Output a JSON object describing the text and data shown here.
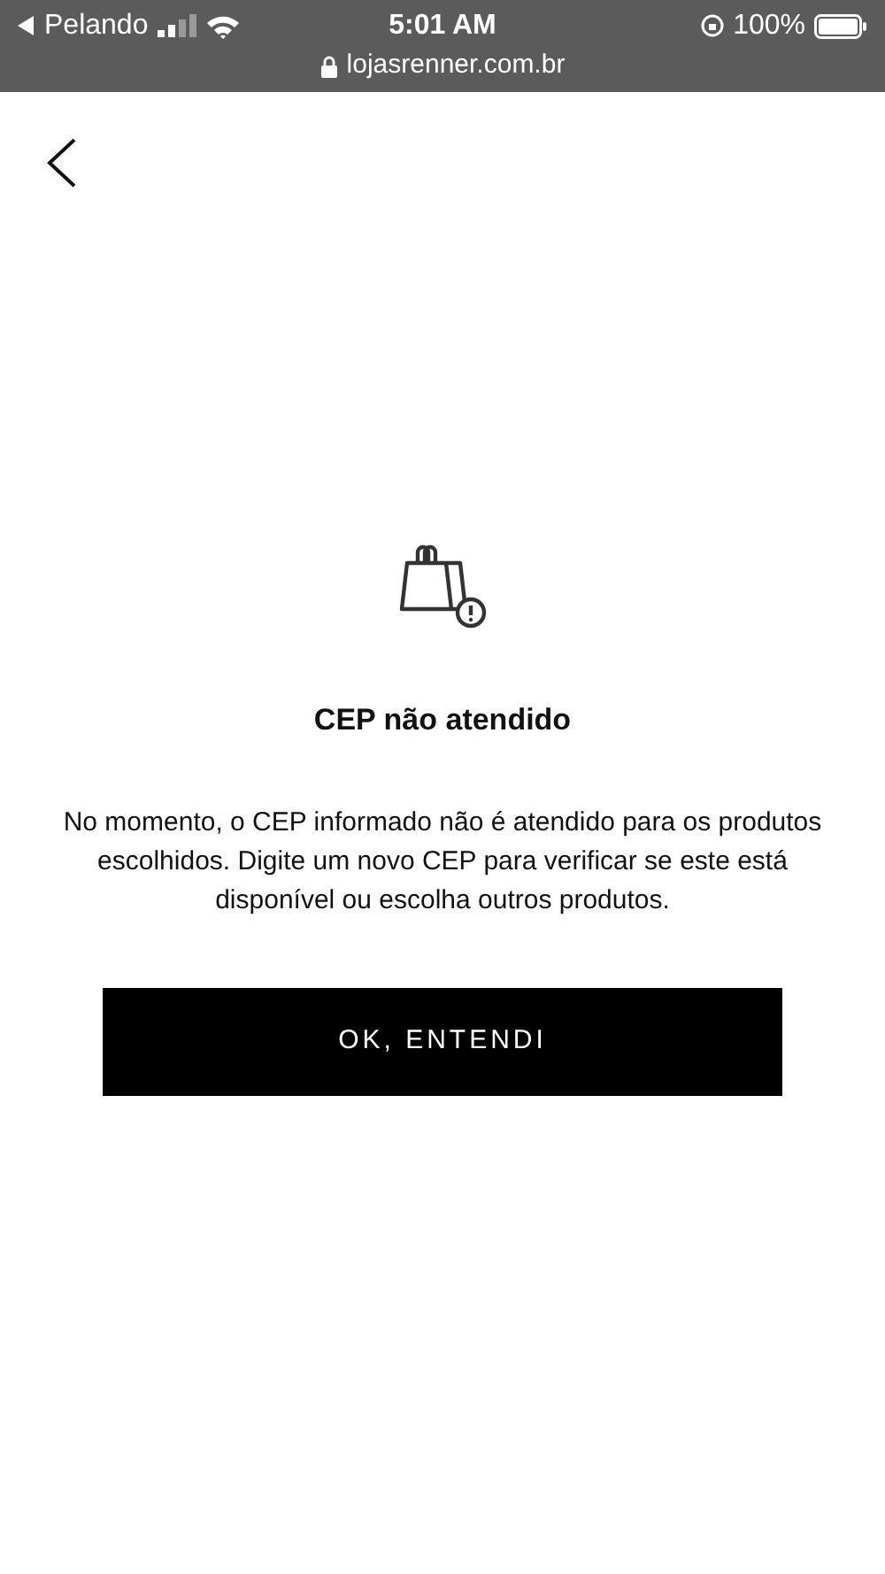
{
  "status_bar": {
    "back_app": "Pelando",
    "time": "5:01 AM",
    "battery": "100%",
    "url": "lojasrenner.com.br"
  },
  "dialog": {
    "title": "CEP não atendido",
    "message": "No momento, o CEP informado não é atendido para os produtos escolhidos. Digite um novo CEP para verificar se este está disponível ou escolha outros produtos.",
    "button": "OK, ENTENDI"
  }
}
